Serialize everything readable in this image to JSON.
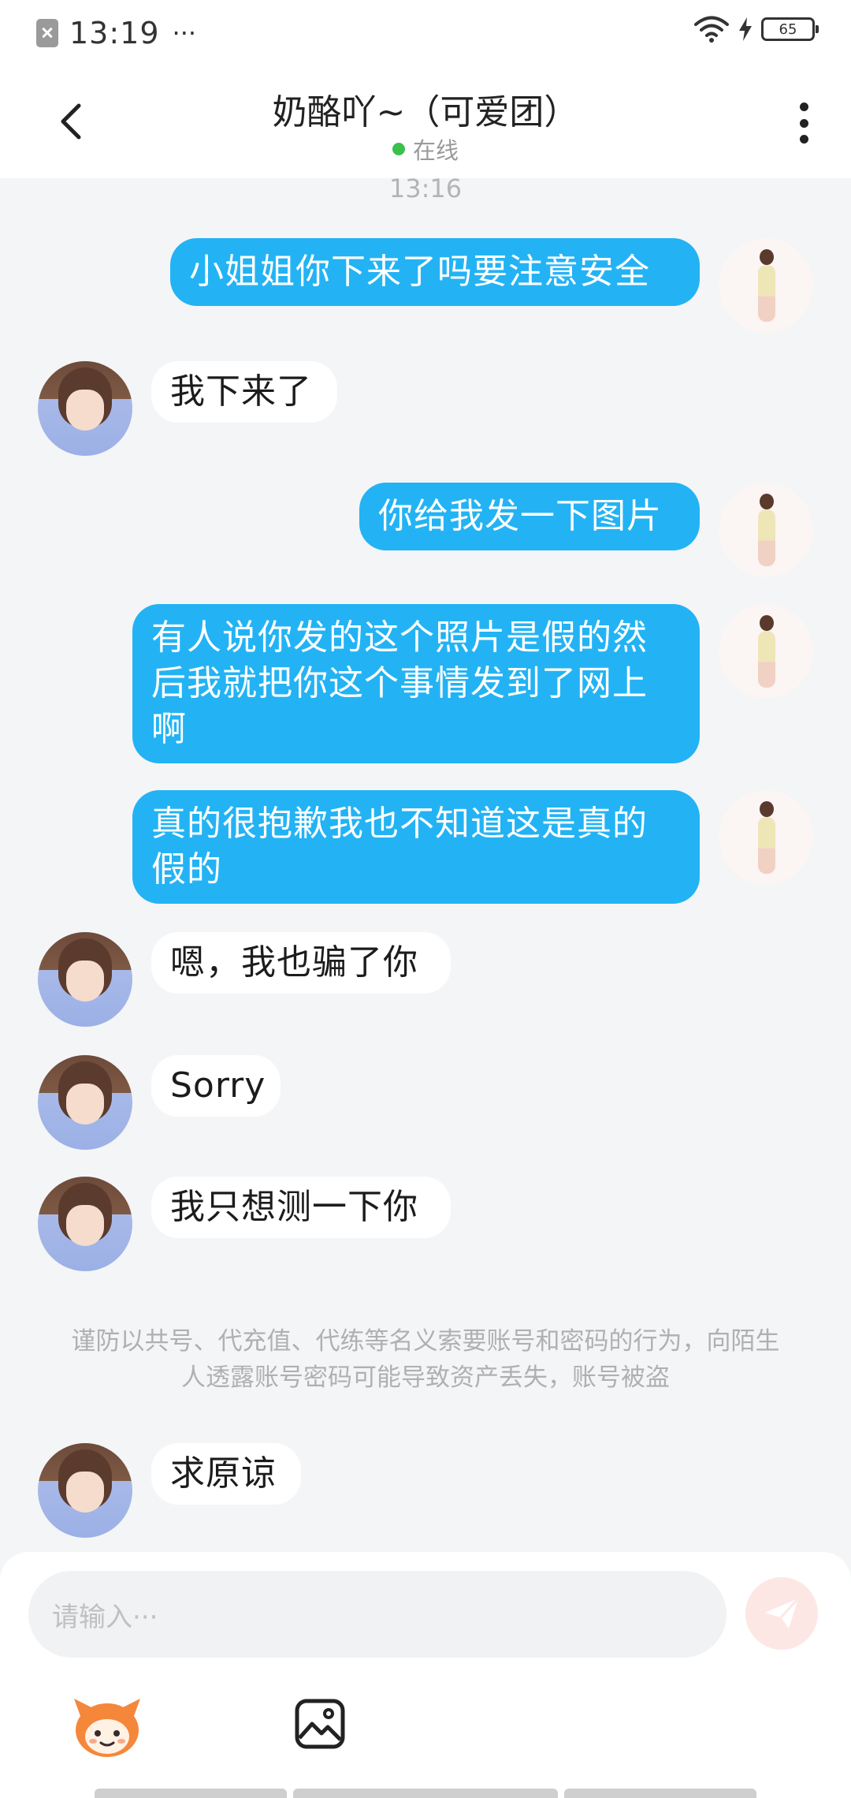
{
  "status_bar": {
    "time": "13:19",
    "dots": "···",
    "battery": "65"
  },
  "header": {
    "title": "奶酪吖~（可爱团）",
    "status": "在线"
  },
  "chat": {
    "timestamp": "13:16",
    "messages": [
      {
        "sender": "me",
        "text": "小姐姐你下来了吗要注意安全"
      },
      {
        "sender": "them",
        "text": "我下来了"
      },
      {
        "sender": "me",
        "text": "你给我发一下图片"
      },
      {
        "sender": "me",
        "text": "有人说你发的这个照片是假的然后我就把你这个事情发到了网上啊"
      },
      {
        "sender": "me",
        "text": "真的很抱歉我也不知道这是真的假的"
      },
      {
        "sender": "them",
        "text": "嗯，我也骗了你"
      },
      {
        "sender": "them",
        "text": "Sorry"
      },
      {
        "sender": "them",
        "text": "我只想测一下你"
      },
      {
        "sender": "them",
        "text": "求原谅"
      }
    ],
    "notice": "谨防以共号、代充值、代练等名义索要账号和密码的行为，向陌生人透露账号密码可能导致资产丢失，账号被盗"
  },
  "input": {
    "placeholder": "请输入···"
  },
  "colors": {
    "my_bubble": "#23b3f4",
    "their_bubble": "#ffffff",
    "background": "#f4f5f7",
    "online": "#3cc04d",
    "send_button": "#fde7e5"
  },
  "icons": {
    "back": "chevron-left-icon",
    "more": "more-vertical-icon",
    "send": "paper-plane-icon",
    "emoji": "mascot-face-icon",
    "image": "image-icon"
  }
}
